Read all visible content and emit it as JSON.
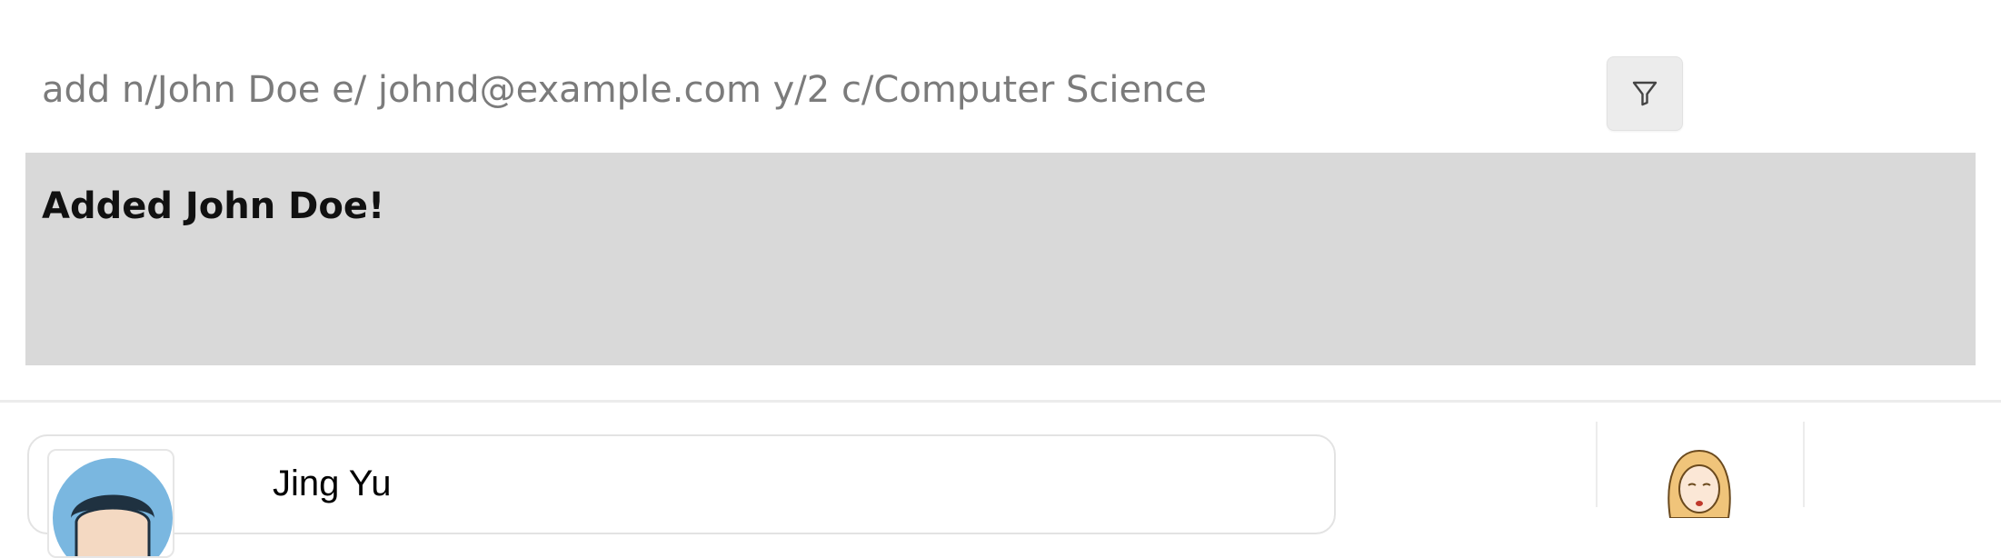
{
  "command_bar": {
    "input_value": "add n/John Doe e/ johnd@example.com y/2 c/Computer Science",
    "filter_icon": "filter-funnel-icon"
  },
  "result": {
    "message": "Added John Doe!"
  },
  "person_list": {
    "cards": [
      {
        "name": "Jing Yu",
        "avatar": "avatar-person-icon"
      }
    ]
  },
  "side_panel": {
    "avatar": "avatar-girl-icon"
  },
  "colors": {
    "command_text": "#7b7b7b",
    "result_bg": "#d9d9d9",
    "avatar_accent": "#7ab7e0",
    "side_avatar_hair": "#f0c47a"
  }
}
